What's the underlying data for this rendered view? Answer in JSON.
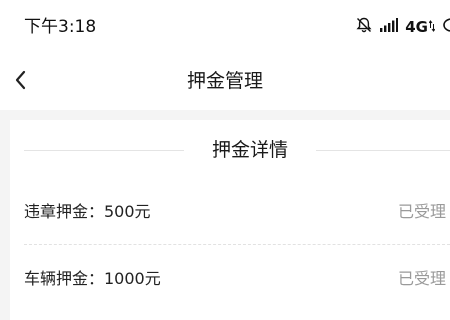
{
  "status_bar": {
    "time": "下午3:18",
    "network": "4G",
    "icons": [
      "bell-off-icon",
      "signal-icon",
      "network-4g-icon"
    ]
  },
  "header": {
    "title": "押金管理",
    "back_icon": "chevron-left-icon"
  },
  "deposit_details": {
    "section_title": "押金详情",
    "items": [
      {
        "label": "违章押金：500元",
        "status": "已受理"
      },
      {
        "label": "车辆押金：1000元",
        "status": "已受理"
      }
    ]
  },
  "colors": {
    "background": "#f4f4f4",
    "surface": "#ffffff",
    "primary_text": "#222222",
    "secondary_text": "#9a9a9a",
    "divider": "#e4e4e4"
  }
}
